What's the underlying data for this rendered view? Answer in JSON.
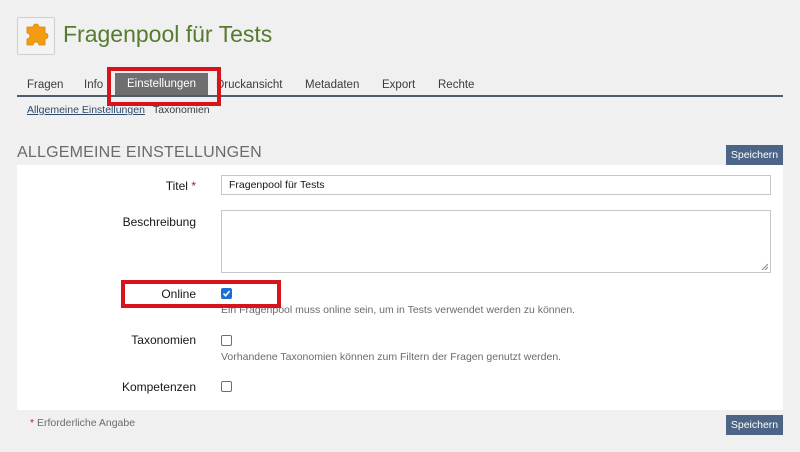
{
  "header": {
    "title": "Fragenpool für Tests",
    "icon": "puzzle-icon",
    "icon_color": "#f39c12"
  },
  "tabs": [
    {
      "label": "Fragen",
      "active": false
    },
    {
      "label": "Info",
      "active": false
    },
    {
      "label": "Einstellungen",
      "active": true
    },
    {
      "label": "Druckansicht",
      "active": false
    },
    {
      "label": "Metadaten",
      "active": false
    },
    {
      "label": "Export",
      "active": false
    },
    {
      "label": "Rechte",
      "active": false
    }
  ],
  "subtabs": [
    {
      "label": "Allgemeine Einstellungen",
      "active": true
    },
    {
      "label": "Taxonomien",
      "active": false
    }
  ],
  "section": {
    "title": "ALLGEMEINE EINSTELLUNGEN",
    "save_label": "Speichern"
  },
  "form": {
    "title_label": "Titel",
    "required_marker": "*",
    "title_value": "Fragenpool für Tests",
    "description_label": "Beschreibung",
    "description_value": "",
    "online_label": "Online",
    "online_checked": true,
    "online_help": "Ein Fragenpool muss online sein, um in Tests verwendet werden zu können.",
    "taxonomies_label": "Taxonomien",
    "taxonomies_checked": false,
    "taxonomies_help": "Vorhandene Taxonomien können zum Filtern der Fragen genutzt werden.",
    "competences_label": "Kompetenzen",
    "competences_checked": false
  },
  "footer": {
    "required_marker": "*",
    "required_note": "Erforderliche Angabe",
    "save_label": "Speichern"
  },
  "colors": {
    "title_green": "#557b2e",
    "tab_active_bg": "#6f6f6f",
    "button_bg": "#4c6586",
    "highlight_red": "#d7131b",
    "checkbox_blue": "#1a6fd1"
  }
}
